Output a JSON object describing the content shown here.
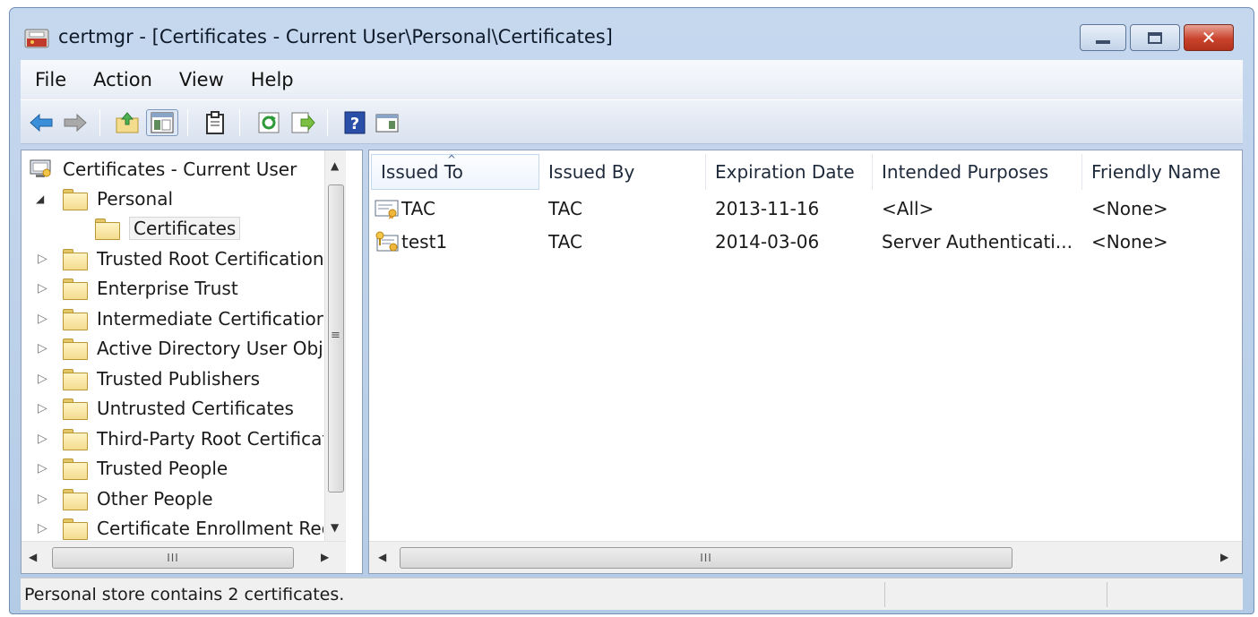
{
  "window": {
    "title": "certmgr - [Certificates - Current User\\Personal\\Certificates]",
    "close_glyph": "✕"
  },
  "menu": [
    "File",
    "Action",
    "View",
    "Help"
  ],
  "toolbar_icons": [
    "back-arrow-icon",
    "forward-arrow-icon",
    "up-folder-icon",
    "show-hide-tree-icon",
    "clipboard-icon",
    "refresh-icon",
    "export-list-icon",
    "help-icon",
    "action-pane-icon"
  ],
  "tree": {
    "root": "Certificates - Current User",
    "items": [
      {
        "label": "Personal",
        "expander": "◢"
      },
      {
        "label": "Certificates"
      },
      {
        "label": "Trusted Root Certification Authorities",
        "expander": "▷"
      },
      {
        "label": "Enterprise Trust",
        "expander": "▷"
      },
      {
        "label": "Intermediate Certification Authorities",
        "expander": "▷"
      },
      {
        "label": "Active Directory User Object",
        "expander": "▷"
      },
      {
        "label": "Trusted Publishers",
        "expander": "▷"
      },
      {
        "label": "Untrusted Certificates",
        "expander": "▷"
      },
      {
        "label": "Third-Party Root Certification Authorities",
        "expander": "▷"
      },
      {
        "label": "Trusted People",
        "expander": "▷"
      },
      {
        "label": "Other People",
        "expander": "▷"
      },
      {
        "label": "Certificate Enrollment Requests",
        "expander": "▷"
      }
    ]
  },
  "scroll_glyphs": {
    "up": "▲",
    "down": "▼",
    "left": "◀",
    "right": "▶",
    "grip_v": "≡",
    "grip_h": "III"
  },
  "columns": [
    "Issued To",
    "Issued By",
    "Expiration Date",
    "Intended Purposes",
    "Friendly Name"
  ],
  "sort_glyph": "^",
  "rows": [
    {
      "issued_to": "TAC",
      "issued_by": "TAC",
      "expiration": "2013-11-16",
      "purposes": "<All>",
      "friendly": "<None>"
    },
    {
      "issued_to": "test1",
      "issued_by": "TAC",
      "expiration": "2014-03-06",
      "purposes": "Server Authenticati...",
      "friendly": "<None>"
    }
  ],
  "status": "Personal store contains 2 certificates.",
  "colors": {
    "title_bg": "#c6d8ee",
    "close_red": "#c9432c",
    "folder": "#f4dc8f"
  }
}
